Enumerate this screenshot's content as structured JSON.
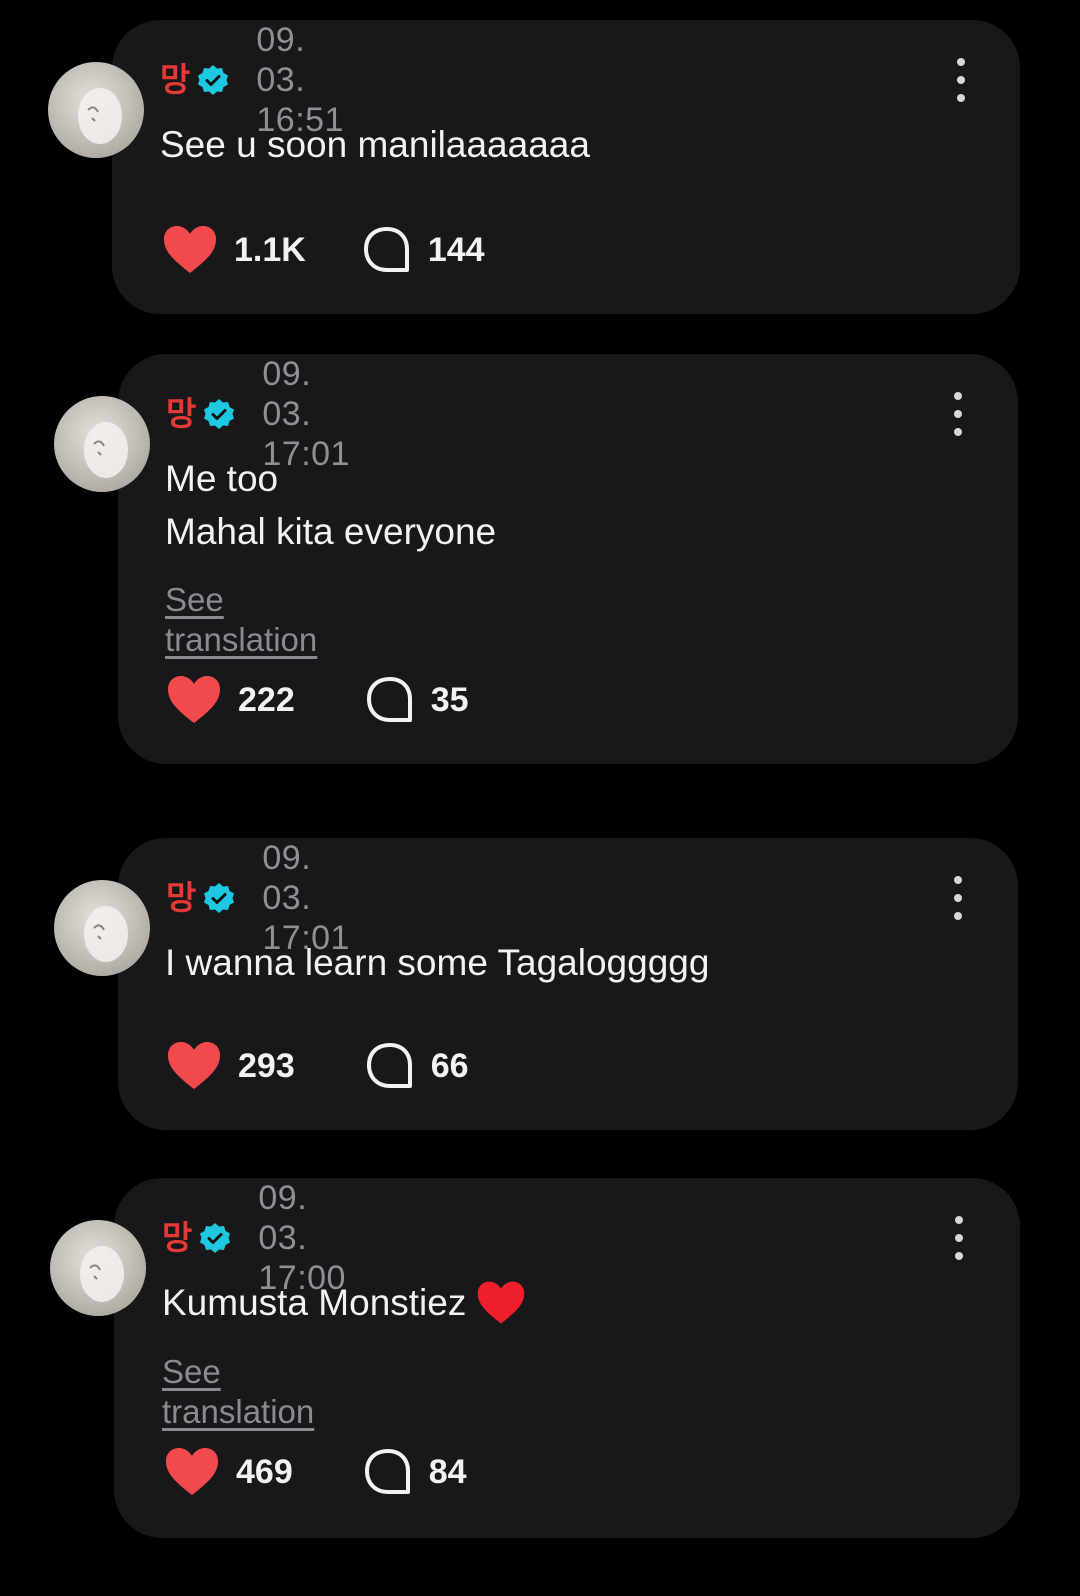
{
  "posts": [
    {
      "username": "망",
      "timestamp": "09. 03. 16:51",
      "lines": [
        "See u soon manilaaaaaaa"
      ],
      "see_translation": "",
      "likes": "1.1K",
      "comments": "144"
    },
    {
      "username": "망",
      "timestamp": "09. 03. 17:01",
      "lines": [
        "Me too",
        "Mahal kita everyone"
      ],
      "see_translation": "See translation",
      "likes": "222",
      "comments": "35"
    },
    {
      "username": "망",
      "timestamp": "09. 03. 17:01",
      "lines": [
        "I wanna learn some Tagaloggggg"
      ],
      "see_translation": "",
      "likes": "293",
      "comments": "66"
    },
    {
      "username": "망",
      "timestamp": "09. 03. 17:00",
      "lines": [
        "Kumusta Monstiez"
      ],
      "see_translation": "See translation",
      "likes": "469",
      "comments": "84",
      "trailing_emoji": "red-heart-icon"
    }
  ],
  "colors": {
    "background": "#000000",
    "card": "#18181a",
    "username": "#e53935",
    "verified": "#1ec8e0",
    "like": "#f2494c",
    "muted": "#8f8f94"
  },
  "icons": {
    "verified": "verified-badge-icon",
    "like": "heart-icon",
    "comment": "comment-bubble-icon",
    "more": "more-vertical-icon"
  }
}
